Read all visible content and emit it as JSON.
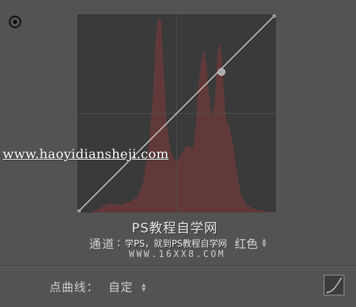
{
  "watermark": {
    "url": "www.haoyidiansheji.com",
    "title": "PS教程自学网",
    "subtitle": "学PS，就到PS教程自学网",
    "site": "WWW.16XX8.COM"
  },
  "channel": {
    "label": "通道",
    "value_fragment": ":",
    "selected": "红色"
  },
  "point_curve": {
    "label": "点曲线：",
    "value": "自定"
  },
  "icons": {
    "target": "target-adjustment-icon",
    "curve": "curve-icon",
    "updown": "updown-arrows-icon"
  },
  "colors": {
    "panel_bg": "#535353",
    "curve_bg": "#3a3a3a",
    "histogram": "#6a3a3a",
    "curve_line": "#dcdcdc"
  }
}
